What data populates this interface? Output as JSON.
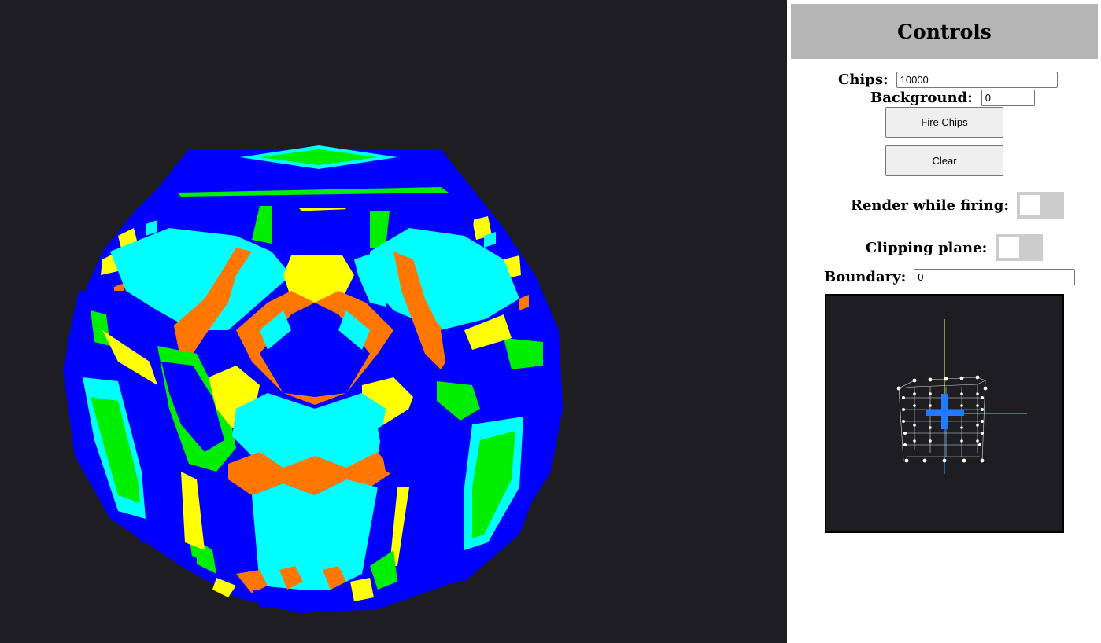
{
  "viewport": {
    "background": "#1e1e22",
    "palette": [
      "#0000ff",
      "#00ffff",
      "#ffff00",
      "#ff7700",
      "#00ee00"
    ]
  },
  "controls": {
    "title": "Controls",
    "chips_label": "Chips:",
    "chips_value": "10000",
    "background_label": "Background:",
    "background_value": "0",
    "fire_button": "Fire Chips",
    "clear_button": "Clear",
    "render_label": "Render while firing:",
    "render_while_firing": false,
    "clipping_label": "Clipping plane:",
    "clipping_plane": false,
    "boundary_label": "Boundary:",
    "boundary_value": "0"
  },
  "minimap": {
    "background": "#1e1e22",
    "axis_colors": [
      "#ffff66",
      "#ffaa33",
      "#33aaff"
    ]
  }
}
